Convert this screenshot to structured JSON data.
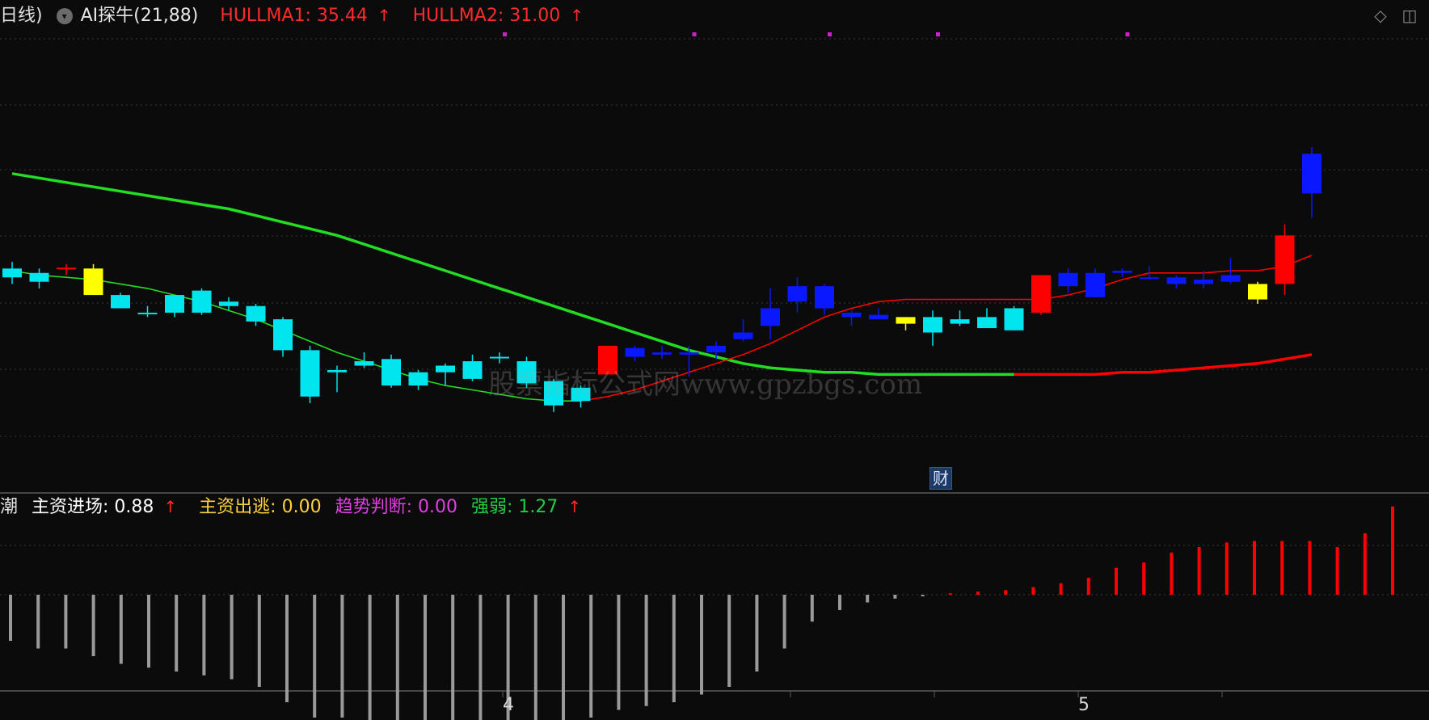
{
  "header": {
    "partial_label": "日线)",
    "indicator_name": "AI探牛(21,88)",
    "hullma1_label": "HULLMA1: 35.44",
    "hullma2_label": "HULLMA2: 31.00",
    "arrow": "↑"
  },
  "sub_header": {
    "partial_label": "潮",
    "main_in": "主资进场: 0.88",
    "main_out": "主资出逃: 0.00",
    "trend": "趋势判断: 0.00",
    "strength": "强弱: 1.27",
    "arrow": "↑"
  },
  "x_labels": [
    "4",
    "5"
  ],
  "badge": "财",
  "watermark": "股票指标公式网www.gpzbgs.com",
  "colors": {
    "background": "#0b0b0c",
    "cyan": "#00e5ee",
    "blue": "#0a18ff",
    "yellow": "#ffff00",
    "red": "#ff0000",
    "green": "#22dd22",
    "magenta": "#cc22cc",
    "gray_bar": "#9a9a9a",
    "hullma": "#ff2a2a",
    "main_out": "#ffd23c",
    "trend": "#e040e0",
    "strength": "#22cc44"
  },
  "chart_data": [
    {
      "type": "candlestick",
      "title": "AI探牛(21,88)",
      "y_range": [
        19.5,
        40
      ],
      "candles": [
        {
          "o": 29.3,
          "h": 29.6,
          "l": 28.6,
          "c": 28.9,
          "color": "cyan"
        },
        {
          "o": 29.1,
          "h": 29.3,
          "l": 28.4,
          "c": 28.7,
          "color": "cyan"
        },
        {
          "o": 29.3,
          "h": 29.5,
          "l": 29.0,
          "c": 29.3,
          "color": "red-cross"
        },
        {
          "o": 28.1,
          "h": 29.5,
          "l": 28.1,
          "c": 29.3,
          "color": "yellow"
        },
        {
          "o": 28.1,
          "h": 28.2,
          "l": 27.5,
          "c": 27.5,
          "color": "cyan"
        },
        {
          "o": 27.3,
          "h": 27.6,
          "l": 27.1,
          "c": 27.3,
          "color": "cyan"
        },
        {
          "o": 28.1,
          "h": 28.1,
          "l": 27.1,
          "c": 27.3,
          "color": "cyan"
        },
        {
          "o": 28.3,
          "h": 28.4,
          "l": 27.2,
          "c": 27.3,
          "color": "cyan"
        },
        {
          "o": 27.8,
          "h": 28.0,
          "l": 27.4,
          "c": 27.6,
          "color": "cyan"
        },
        {
          "o": 27.6,
          "h": 27.7,
          "l": 26.7,
          "c": 26.9,
          "color": "cyan"
        },
        {
          "o": 27.0,
          "h": 27.1,
          "l": 25.3,
          "c": 25.6,
          "color": "cyan"
        },
        {
          "o": 25.6,
          "h": 25.8,
          "l": 23.2,
          "c": 23.5,
          "color": "cyan"
        },
        {
          "o": 24.7,
          "h": 24.9,
          "l": 23.7,
          "c": 24.6,
          "color": "cyan"
        },
        {
          "o": 25.1,
          "h": 25.5,
          "l": 24.8,
          "c": 24.9,
          "color": "cyan"
        },
        {
          "o": 25.2,
          "h": 25.4,
          "l": 23.9,
          "c": 24.0,
          "color": "cyan"
        },
        {
          "o": 24.6,
          "h": 24.7,
          "l": 23.8,
          "c": 24.0,
          "color": "cyan"
        },
        {
          "o": 24.9,
          "h": 25.0,
          "l": 24.0,
          "c": 24.6,
          "color": "cyan"
        },
        {
          "o": 25.1,
          "h": 25.4,
          "l": 24.2,
          "c": 24.3,
          "color": "cyan"
        },
        {
          "o": 25.3,
          "h": 25.5,
          "l": 25.0,
          "c": 25.3,
          "color": "cyan"
        },
        {
          "o": 25.1,
          "h": 25.3,
          "l": 23.9,
          "c": 24.1,
          "color": "cyan"
        },
        {
          "o": 24.2,
          "h": 24.3,
          "l": 22.8,
          "c": 23.1,
          "color": "cyan"
        },
        {
          "o": 23.9,
          "h": 24.0,
          "l": 23.0,
          "c": 23.3,
          "color": "cyan"
        },
        {
          "o": 24.5,
          "h": 25.8,
          "l": 24.5,
          "c": 25.8,
          "color": "red"
        },
        {
          "o": 25.7,
          "h": 25.8,
          "l": 25.1,
          "c": 25.3,
          "color": "blue"
        },
        {
          "o": 25.4,
          "h": 25.8,
          "l": 25.2,
          "c": 25.5,
          "color": "blue"
        },
        {
          "o": 25.5,
          "h": 25.8,
          "l": 24.4,
          "c": 25.4,
          "color": "blue"
        },
        {
          "o": 25.8,
          "h": 26.0,
          "l": 25.2,
          "c": 25.5,
          "color": "blue"
        },
        {
          "o": 26.4,
          "h": 27.0,
          "l": 26.0,
          "c": 26.1,
          "color": "blue"
        },
        {
          "o": 27.5,
          "h": 28.4,
          "l": 26.1,
          "c": 26.7,
          "color": "blue"
        },
        {
          "o": 28.5,
          "h": 28.9,
          "l": 27.3,
          "c": 27.8,
          "color": "blue"
        },
        {
          "o": 28.5,
          "h": 28.6,
          "l": 27.2,
          "c": 27.5,
          "color": "blue"
        },
        {
          "o": 27.3,
          "h": 27.4,
          "l": 26.7,
          "c": 27.1,
          "color": "blue"
        },
        {
          "o": 27.2,
          "h": 27.5,
          "l": 27.0,
          "c": 27.0,
          "color": "blue"
        },
        {
          "o": 26.8,
          "h": 27.1,
          "l": 26.5,
          "c": 27.1,
          "color": "yellow"
        },
        {
          "o": 27.1,
          "h": 27.4,
          "l": 25.8,
          "c": 26.4,
          "color": "cyan"
        },
        {
          "o": 27.0,
          "h": 27.4,
          "l": 26.7,
          "c": 26.8,
          "color": "cyan"
        },
        {
          "o": 27.1,
          "h": 27.5,
          "l": 26.6,
          "c": 26.6,
          "color": "cyan"
        },
        {
          "o": 26.5,
          "h": 27.6,
          "l": 26.5,
          "c": 27.5,
          "color": "cyan"
        },
        {
          "o": 27.3,
          "h": 29.0,
          "l": 27.2,
          "c": 29.0,
          "color": "red"
        },
        {
          "o": 29.1,
          "h": 29.3,
          "l": 28.2,
          "c": 28.5,
          "color": "blue"
        },
        {
          "o": 29.1,
          "h": 29.3,
          "l": 28.0,
          "c": 28.0,
          "color": "blue"
        },
        {
          "o": 29.2,
          "h": 29.3,
          "l": 28.9,
          "c": 29.1,
          "color": "blue"
        },
        {
          "o": 28.9,
          "h": 29.4,
          "l": 28.8,
          "c": 28.9,
          "color": "blue"
        },
        {
          "o": 28.9,
          "h": 29.0,
          "l": 28.4,
          "c": 28.6,
          "color": "blue"
        },
        {
          "o": 28.8,
          "h": 29.2,
          "l": 28.4,
          "c": 28.6,
          "color": "blue"
        },
        {
          "o": 29.0,
          "h": 29.8,
          "l": 28.6,
          "c": 28.7,
          "color": "blue"
        },
        {
          "o": 27.9,
          "h": 28.7,
          "l": 27.7,
          "c": 28.6,
          "color": "yellow"
        },
        {
          "o": 28.6,
          "h": 31.3,
          "l": 28.1,
          "c": 30.8,
          "color": "red"
        },
        {
          "o": 34.5,
          "h": 34.8,
          "l": 31.6,
          "c": 32.7,
          "color": "blue"
        }
      ],
      "thin_line": {
        "color_segments": [
          "green",
          "red"
        ],
        "values": [
          29.2,
          29.0,
          28.9,
          28.8,
          28.6,
          28.4,
          28.1,
          27.8,
          27.4,
          27.0,
          26.5,
          26.0,
          25.5,
          25.1,
          24.7,
          24.3,
          24.0,
          23.8,
          23.6,
          23.4,
          23.3,
          23.3,
          23.5,
          23.8,
          24.2,
          24.6,
          25.0,
          25.4,
          25.9,
          26.5,
          27.1,
          27.5,
          27.8,
          27.9,
          27.9,
          27.9,
          27.9,
          27.9,
          27.9,
          28.1,
          28.4,
          28.8,
          29.1,
          29.1,
          29.1,
          29.2,
          29.2,
          29.4,
          29.9
        ]
      },
      "thick_line": {
        "color_segments": [
          "green",
          "red"
        ],
        "values": [
          33.6,
          33.4,
          33.2,
          33.0,
          32.8,
          32.6,
          32.4,
          32.2,
          32.0,
          31.7,
          31.4,
          31.1,
          30.8,
          30.4,
          30.0,
          29.6,
          29.2,
          28.8,
          28.4,
          28.0,
          27.6,
          27.2,
          26.8,
          26.4,
          26.0,
          25.6,
          25.3,
          25.0,
          24.8,
          24.7,
          24.6,
          24.6,
          24.5,
          24.5,
          24.5,
          24.5,
          24.5,
          24.5,
          24.5,
          24.5,
          24.5,
          24.6,
          24.6,
          24.7,
          24.8,
          24.9,
          25.0,
          25.2,
          25.4
        ]
      },
      "markers_top_indices": [
        18,
        25,
        30,
        34,
        41
      ]
    },
    {
      "type": "bar",
      "title": "",
      "series_name": "",
      "values": [
        -0.6,
        -0.7,
        -0.7,
        -0.8,
        -0.9,
        -0.95,
        -1.0,
        -1.05,
        -1.1,
        -1.2,
        -1.4,
        -1.6,
        -1.6,
        -1.7,
        -1.75,
        -1.8,
        -1.75,
        -1.75,
        -1.75,
        -1.7,
        -1.65,
        -1.6,
        -1.5,
        -1.45,
        -1.4,
        -1.3,
        -1.2,
        -1.0,
        -0.7,
        -0.35,
        -0.2,
        -0.1,
        -0.05,
        -0.02,
        0.02,
        0.04,
        0.06,
        0.1,
        0.15,
        0.22,
        0.35,
        0.42,
        0.55,
        0.62,
        0.68,
        0.7,
        0.7,
        0.7,
        0.62,
        0.8,
        1.15
      ]
    }
  ]
}
